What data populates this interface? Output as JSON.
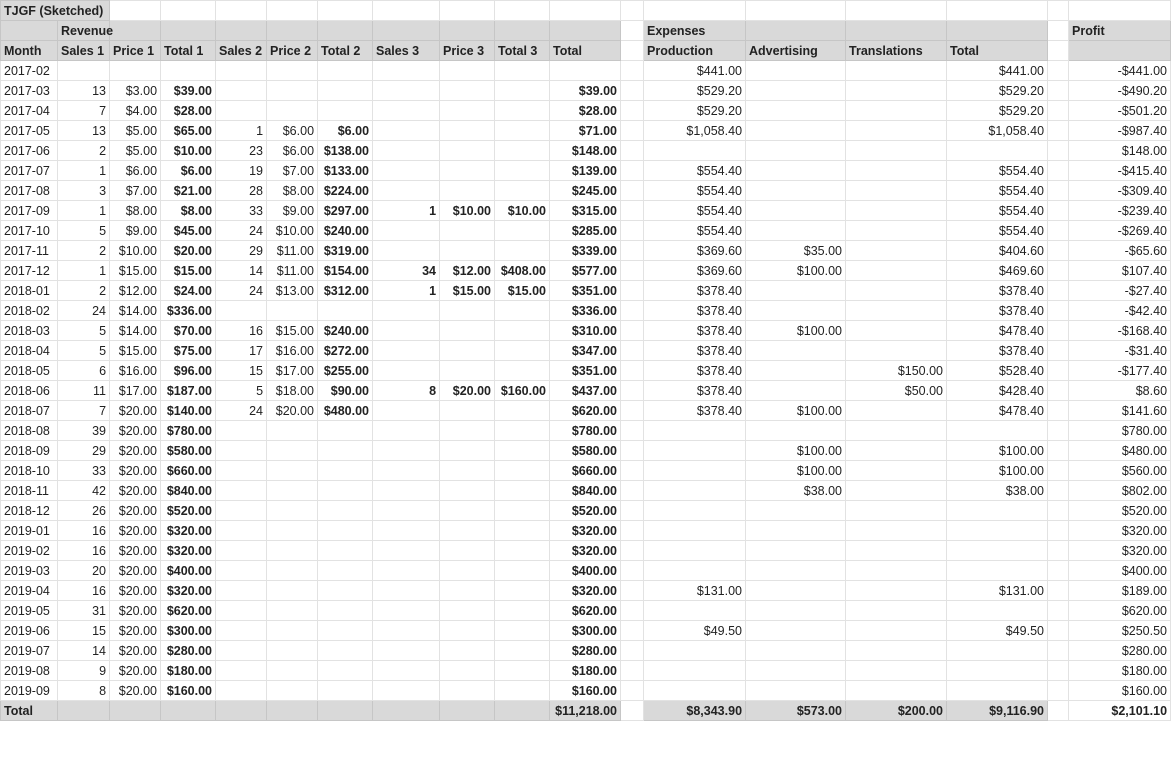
{
  "title": "TJGF (Sketched)",
  "groups": {
    "revenue": "Revenue",
    "expenses": "Expenses",
    "profit": "Profit"
  },
  "headers": [
    "Month",
    "Sales 1",
    "Price 1",
    "Total 1",
    "Sales 2",
    "Price 2",
    "Total 2",
    "Sales 3",
    "Price 3",
    "Total 3",
    "Total",
    "Production",
    "Advertising",
    "Translations",
    "Total"
  ],
  "columns": [
    "month",
    "sales1",
    "price1",
    "total1",
    "sales2",
    "price2",
    "total2",
    "sales3",
    "price3",
    "total3",
    "revenue_total",
    "production",
    "advertising",
    "translations",
    "expenses_total",
    "profit"
  ],
  "rows": [
    [
      "2017-02",
      "",
      "",
      "",
      "",
      "",
      "",
      "",
      "",
      "",
      "",
      "$441.00",
      "",
      "",
      "$441.00",
      "-$441.00"
    ],
    [
      "2017-03",
      "13",
      "$3.00",
      "$39.00",
      "",
      "",
      "",
      "",
      "",
      "",
      "$39.00",
      "$529.20",
      "",
      "",
      "$529.20",
      "-$490.20"
    ],
    [
      "2017-04",
      "7",
      "$4.00",
      "$28.00",
      "",
      "",
      "",
      "",
      "",
      "",
      "$28.00",
      "$529.20",
      "",
      "",
      "$529.20",
      "-$501.20"
    ],
    [
      "2017-05",
      "13",
      "$5.00",
      "$65.00",
      "1",
      "$6.00",
      "$6.00",
      "",
      "",
      "",
      "$71.00",
      "$1,058.40",
      "",
      "",
      "$1,058.40",
      "-$987.40"
    ],
    [
      "2017-06",
      "2",
      "$5.00",
      "$10.00",
      "23",
      "$6.00",
      "$138.00",
      "",
      "",
      "",
      "$148.00",
      "",
      "",
      "",
      "",
      "$148.00"
    ],
    [
      "2017-07",
      "1",
      "$6.00",
      "$6.00",
      "19",
      "$7.00",
      "$133.00",
      "",
      "",
      "",
      "$139.00",
      "$554.40",
      "",
      "",
      "$554.40",
      "-$415.40"
    ],
    [
      "2017-08",
      "3",
      "$7.00",
      "$21.00",
      "28",
      "$8.00",
      "$224.00",
      "",
      "",
      "",
      "$245.00",
      "$554.40",
      "",
      "",
      "$554.40",
      "-$309.40"
    ],
    [
      "2017-09",
      "1",
      "$8.00",
      "$8.00",
      "33",
      "$9.00",
      "$297.00",
      "1",
      "$10.00",
      "$10.00",
      "$315.00",
      "$554.40",
      "",
      "",
      "$554.40",
      "-$239.40"
    ],
    [
      "2017-10",
      "5",
      "$9.00",
      "$45.00",
      "24",
      "$10.00",
      "$240.00",
      "",
      "",
      "",
      "$285.00",
      "$554.40",
      "",
      "",
      "$554.40",
      "-$269.40"
    ],
    [
      "2017-11",
      "2",
      "$10.00",
      "$20.00",
      "29",
      "$11.00",
      "$319.00",
      "",
      "",
      "",
      "$339.00",
      "$369.60",
      "$35.00",
      "",
      "$404.60",
      "-$65.60"
    ],
    [
      "2017-12",
      "1",
      "$15.00",
      "$15.00",
      "14",
      "$11.00",
      "$154.00",
      "34",
      "$12.00",
      "$408.00",
      "$577.00",
      "$369.60",
      "$100.00",
      "",
      "$469.60",
      "$107.40"
    ],
    [
      "2018-01",
      "2",
      "$12.00",
      "$24.00",
      "24",
      "$13.00",
      "$312.00",
      "1",
      "$15.00",
      "$15.00",
      "$351.00",
      "$378.40",
      "",
      "",
      "$378.40",
      "-$27.40"
    ],
    [
      "2018-02",
      "24",
      "$14.00",
      "$336.00",
      "",
      "",
      "",
      "",
      "",
      "",
      "$336.00",
      "$378.40",
      "",
      "",
      "$378.40",
      "-$42.40"
    ],
    [
      "2018-03",
      "5",
      "$14.00",
      "$70.00",
      "16",
      "$15.00",
      "$240.00",
      "",
      "",
      "",
      "$310.00",
      "$378.40",
      "$100.00",
      "",
      "$478.40",
      "-$168.40"
    ],
    [
      "2018-04",
      "5",
      "$15.00",
      "$75.00",
      "17",
      "$16.00",
      "$272.00",
      "",
      "",
      "",
      "$347.00",
      "$378.40",
      "",
      "",
      "$378.40",
      "-$31.40"
    ],
    [
      "2018-05",
      "6",
      "$16.00",
      "$96.00",
      "15",
      "$17.00",
      "$255.00",
      "",
      "",
      "",
      "$351.00",
      "$378.40",
      "",
      "$150.00",
      "$528.40",
      "-$177.40"
    ],
    [
      "2018-06",
      "11",
      "$17.00",
      "$187.00",
      "5",
      "$18.00",
      "$90.00",
      "8",
      "$20.00",
      "$160.00",
      "$437.00",
      "$378.40",
      "",
      "$50.00",
      "$428.40",
      "$8.60"
    ],
    [
      "2018-07",
      "7",
      "$20.00",
      "$140.00",
      "24",
      "$20.00",
      "$480.00",
      "",
      "",
      "",
      "$620.00",
      "$378.40",
      "$100.00",
      "",
      "$478.40",
      "$141.60"
    ],
    [
      "2018-08",
      "39",
      "$20.00",
      "$780.00",
      "",
      "",
      "",
      "",
      "",
      "",
      "$780.00",
      "",
      "",
      "",
      "",
      "$780.00"
    ],
    [
      "2018-09",
      "29",
      "$20.00",
      "$580.00",
      "",
      "",
      "",
      "",
      "",
      "",
      "$580.00",
      "",
      "$100.00",
      "",
      "$100.00",
      "$480.00"
    ],
    [
      "2018-10",
      "33",
      "$20.00",
      "$660.00",
      "",
      "",
      "",
      "",
      "",
      "",
      "$660.00",
      "",
      "$100.00",
      "",
      "$100.00",
      "$560.00"
    ],
    [
      "2018-11",
      "42",
      "$20.00",
      "$840.00",
      "",
      "",
      "",
      "",
      "",
      "",
      "$840.00",
      "",
      "$38.00",
      "",
      "$38.00",
      "$802.00"
    ],
    [
      "2018-12",
      "26",
      "$20.00",
      "$520.00",
      "",
      "",
      "",
      "",
      "",
      "",
      "$520.00",
      "",
      "",
      "",
      "",
      "$520.00"
    ],
    [
      "2019-01",
      "16",
      "$20.00",
      "$320.00",
      "",
      "",
      "",
      "",
      "",
      "",
      "$320.00",
      "",
      "",
      "",
      "",
      "$320.00"
    ],
    [
      "2019-02",
      "16",
      "$20.00",
      "$320.00",
      "",
      "",
      "",
      "",
      "",
      "",
      "$320.00",
      "",
      "",
      "",
      "",
      "$320.00"
    ],
    [
      "2019-03",
      "20",
      "$20.00",
      "$400.00",
      "",
      "",
      "",
      "",
      "",
      "",
      "$400.00",
      "",
      "",
      "",
      "",
      "$400.00"
    ],
    [
      "2019-04",
      "16",
      "$20.00",
      "$320.00",
      "",
      "",
      "",
      "",
      "",
      "",
      "$320.00",
      "$131.00",
      "",
      "",
      "$131.00",
      "$189.00"
    ],
    [
      "2019-05",
      "31",
      "$20.00",
      "$620.00",
      "",
      "",
      "",
      "",
      "",
      "",
      "$620.00",
      "",
      "",
      "",
      "",
      "$620.00"
    ],
    [
      "2019-06",
      "15",
      "$20.00",
      "$300.00",
      "",
      "",
      "",
      "",
      "",
      "",
      "$300.00",
      "$49.50",
      "",
      "",
      "$49.50",
      "$250.50"
    ],
    [
      "2019-07",
      "14",
      "$20.00",
      "$280.00",
      "",
      "",
      "",
      "",
      "",
      "",
      "$280.00",
      "",
      "",
      "",
      "",
      "$280.00"
    ],
    [
      "2019-08",
      "9",
      "$20.00",
      "$180.00",
      "",
      "",
      "",
      "",
      "",
      "",
      "$180.00",
      "",
      "",
      "",
      "",
      "$180.00"
    ],
    [
      "2019-09",
      "8",
      "$20.00",
      "$160.00",
      "",
      "",
      "",
      "",
      "",
      "",
      "$160.00",
      "",
      "",
      "",
      "",
      "$160.00"
    ]
  ],
  "totals": [
    "Total",
    "",
    "",
    "",
    "",
    "",
    "",
    "",
    "",
    "",
    "$11,218.00",
    "$8,343.90",
    "$573.00",
    "$200.00",
    "$9,116.90",
    "$2,101.10"
  ]
}
